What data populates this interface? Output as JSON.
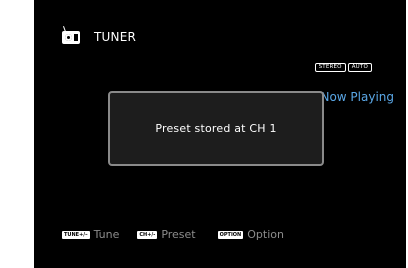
{
  "header": {
    "title": "TUNER",
    "icon": "radio-icon"
  },
  "badges": [
    "STEREO",
    "AUTO"
  ],
  "now_playing": "Now Playing",
  "dialog": {
    "message": "Preset stored at CH 1"
  },
  "footer": {
    "hints": [
      {
        "key": "TUNE+/–",
        "label": "Tune"
      },
      {
        "key": "CH+/-",
        "label": "Preset"
      },
      {
        "key": "OPTION",
        "label": "Option"
      }
    ]
  },
  "colors": {
    "background": "#000000",
    "accent": "#5aa7e6",
    "dialog_border": "#8a8a8a"
  }
}
